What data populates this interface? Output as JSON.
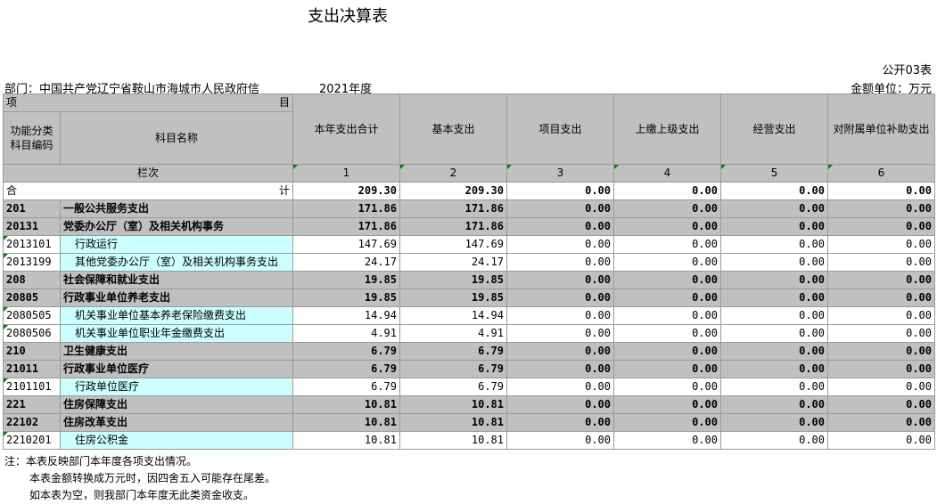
{
  "title": "支出决算表",
  "public_no": "公开03表",
  "department": "部门：中国共产党辽宁省鞍山市海城市人民政府信",
  "year": "2021年度",
  "unit": "金额单位：万元",
  "header": {
    "xiang": "项",
    "mu": "目",
    "code_label": "功能分类\n科目编码",
    "name_label": "科目名称",
    "columns": [
      "本年支出合计",
      "基本支出",
      "项目支出",
      "上缴上级支出",
      "经营支出",
      "对附属单位补助支出"
    ],
    "lanci": "栏次",
    "column_numbers": [
      "1",
      "2",
      "3",
      "4",
      "5",
      "6"
    ]
  },
  "total": {
    "left": "合",
    "right": "计",
    "values": [
      "209.30",
      "209.30",
      "0.00",
      "0.00",
      "0.00",
      "0.00"
    ]
  },
  "rows": [
    {
      "level": 1,
      "code": "201",
      "name": "一般公共服务支出",
      "values": [
        "171.86",
        "171.86",
        "0.00",
        "0.00",
        "0.00",
        "0.00"
      ]
    },
    {
      "level": 2,
      "code": "20131",
      "name": "党委办公厅（室）及相关机构事务",
      "values": [
        "171.86",
        "171.86",
        "0.00",
        "0.00",
        "0.00",
        "0.00"
      ]
    },
    {
      "level": 3,
      "code": "2013101",
      "name": "行政运行",
      "values": [
        "147.69",
        "147.69",
        "0.00",
        "0.00",
        "0.00",
        "0.00"
      ]
    },
    {
      "level": 3,
      "code": "2013199",
      "name": "其他党委办公厅（室）及相关机构事务支出",
      "values": [
        "24.17",
        "24.17",
        "0.00",
        "0.00",
        "0.00",
        "0.00"
      ]
    },
    {
      "level": 1,
      "code": "208",
      "name": "社会保障和就业支出",
      "values": [
        "19.85",
        "19.85",
        "0.00",
        "0.00",
        "0.00",
        "0.00"
      ]
    },
    {
      "level": 2,
      "code": "20805",
      "name": "行政事业单位养老支出",
      "values": [
        "19.85",
        "19.85",
        "0.00",
        "0.00",
        "0.00",
        "0.00"
      ]
    },
    {
      "level": 3,
      "code": "2080505",
      "name": "机关事业单位基本养老保险缴费支出",
      "values": [
        "14.94",
        "14.94",
        "0.00",
        "0.00",
        "0.00",
        "0.00"
      ]
    },
    {
      "level": 3,
      "code": "2080506",
      "name": "机关事业单位职业年金缴费支出",
      "values": [
        "4.91",
        "4.91",
        "0.00",
        "0.00",
        "0.00",
        "0.00"
      ]
    },
    {
      "level": 1,
      "code": "210",
      "name": "卫生健康支出",
      "values": [
        "6.79",
        "6.79",
        "0.00",
        "0.00",
        "0.00",
        "0.00"
      ]
    },
    {
      "level": 2,
      "code": "21011",
      "name": "行政事业单位医疗",
      "values": [
        "6.79",
        "6.79",
        "0.00",
        "0.00",
        "0.00",
        "0.00"
      ]
    },
    {
      "level": 3,
      "code": "2101101",
      "name": "行政单位医疗",
      "values": [
        "6.79",
        "6.79",
        "0.00",
        "0.00",
        "0.00",
        "0.00"
      ]
    },
    {
      "level": 1,
      "code": "221",
      "name": "住房保障支出",
      "values": [
        "10.81",
        "10.81",
        "0.00",
        "0.00",
        "0.00",
        "0.00"
      ]
    },
    {
      "level": 2,
      "code": "22102",
      "name": "住房改革支出",
      "values": [
        "10.81",
        "10.81",
        "0.00",
        "0.00",
        "0.00",
        "0.00"
      ]
    },
    {
      "level": 3,
      "code": "2210201",
      "name": "住房公积金",
      "values": [
        "10.81",
        "10.81",
        "0.00",
        "0.00",
        "0.00",
        "0.00"
      ]
    }
  ],
  "notes": [
    "注：本表反映部门本年度各项支出情况。",
    "本表金额转换成万元时，因四舍五入可能存在尾差。",
    "如本表为空，则我部门本年度无此类资金收支。"
  ]
}
